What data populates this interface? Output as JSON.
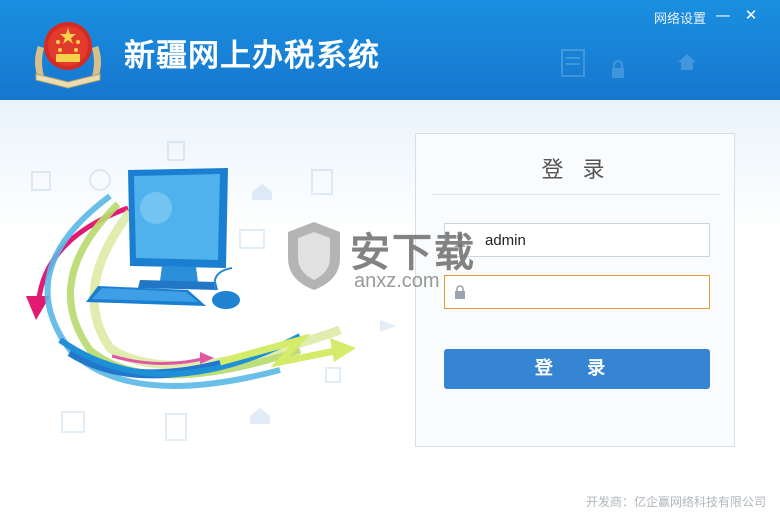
{
  "header": {
    "app_title": "新疆网上办税系统",
    "network_settings": "网络设置",
    "minimize_symbol": "—",
    "close_symbol": "✕"
  },
  "login": {
    "title": "登 录",
    "username_value": "admin",
    "password_value": "",
    "button_label": "登 录"
  },
  "watermark": {
    "text": "安下载",
    "sub": "anxz.com"
  },
  "footer": {
    "developer": "开发商：亿企赢网络科技有限公司"
  },
  "colors": {
    "header_blue": "#1a8fe0",
    "button_blue": "#3585d3",
    "focus_border": "#e29a38"
  },
  "icons": [
    "emblem-icon",
    "user-icon",
    "lock-icon",
    "computer-icon",
    "keyboard-icon",
    "mouse-icon"
  ]
}
